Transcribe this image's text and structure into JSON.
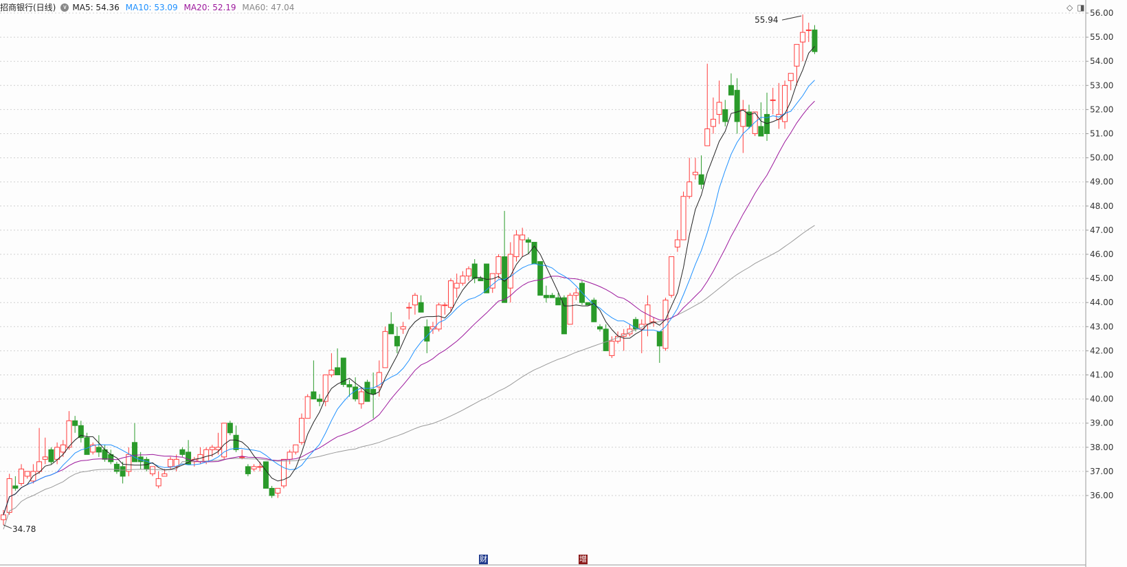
{
  "header": {
    "title": "招商银行(日线)",
    "ma5": "MA5: 54.36",
    "ma10": "MA10: 53.09",
    "ma20": "MA20: 52.19",
    "ma60": "MA60: 47.04"
  },
  "colors": {
    "up": "#ff3b3b",
    "down": "#2a9a2a",
    "ma5": "#222222",
    "ma10": "#1e90ff",
    "ma20": "#9c179c",
    "ma60": "#999999",
    "grid": "#cfcfcf"
  },
  "events": [
    {
      "label": "财",
      "color": "#1f3a8c"
    },
    {
      "label": "增",
      "color": "#8b1a1a"
    }
  ],
  "chart_data": {
    "type": "candlestick",
    "y_axis_side": "right",
    "ylim": [
      34.5,
      56.3
    ],
    "y_ticks": [
      "56.00",
      "55.00",
      "54.00",
      "53.00",
      "52.00",
      "51.00",
      "50.00",
      "49.00",
      "48.00",
      "47.00",
      "46.00",
      "45.00",
      "44.00",
      "43.00",
      "42.00",
      "41.00",
      "40.00",
      "39.00",
      "38.00",
      "37.00",
      "36.00"
    ],
    "annotations": [
      {
        "label": "55.94",
        "type": "period-high"
      },
      {
        "label": "34.78",
        "type": "period-low"
      }
    ],
    "candles": [
      [
        35.0,
        35.4,
        34.78,
        35.2
      ],
      [
        35.3,
        36.9,
        35.2,
        36.7
      ],
      [
        36.4,
        36.8,
        36.2,
        36.3
      ],
      [
        36.5,
        37.3,
        36.4,
        37.1
      ],
      [
        36.8,
        37.0,
        36.7,
        37.0
      ],
      [
        36.6,
        37.3,
        36.5,
        37.0
      ],
      [
        37.0,
        38.8,
        36.9,
        37.4
      ],
      [
        37.5,
        38.4,
        37.3,
        37.6
      ],
      [
        37.9,
        38.0,
        37.3,
        37.4
      ],
      [
        37.5,
        38.2,
        37.3,
        38.0
      ],
      [
        37.8,
        38.3,
        37.6,
        38.1
      ],
      [
        38.0,
        39.5,
        37.9,
        39.1
      ],
      [
        39.1,
        39.3,
        38.6,
        38.9
      ],
      [
        38.9,
        39.1,
        38.2,
        38.4
      ],
      [
        38.4,
        38.6,
        37.7,
        37.7
      ],
      [
        37.8,
        38.2,
        37.7,
        38.1
      ],
      [
        38.0,
        38.5,
        37.6,
        37.8
      ],
      [
        37.9,
        38.1,
        37.4,
        37.5
      ],
      [
        37.7,
        37.9,
        37.3,
        37.4
      ],
      [
        37.3,
        37.4,
        36.9,
        37.0
      ],
      [
        37.2,
        37.4,
        36.5,
        36.8
      ],
      [
        37.0,
        38.0,
        36.8,
        37.7
      ],
      [
        38.2,
        39.0,
        37.4,
        37.4
      ],
      [
        37.6,
        37.8,
        37.1,
        37.4
      ],
      [
        37.5,
        37.6,
        37.0,
        37.1
      ],
      [
        36.9,
        37.2,
        36.8,
        37.2
      ],
      [
        36.4,
        37.0,
        36.3,
        36.7
      ],
      [
        36.8,
        37.1,
        36.8,
        36.9
      ],
      [
        37.2,
        37.6,
        37.1,
        37.5
      ],
      [
        37.2,
        37.7,
        37.0,
        37.5
      ],
      [
        37.9,
        38.0,
        37.6,
        37.7
      ],
      [
        37.8,
        38.3,
        37.3,
        37.3
      ],
      [
        37.4,
        37.6,
        37.2,
        37.5
      ],
      [
        37.4,
        38.0,
        37.3,
        37.7
      ],
      [
        37.4,
        38.0,
        37.3,
        37.9
      ],
      [
        37.9,
        38.1,
        37.6,
        38.0
      ],
      [
        37.9,
        38.6,
        37.7,
        38.0
      ],
      [
        37.6,
        39.0,
        37.5,
        39.0
      ],
      [
        39.0,
        39.1,
        38.5,
        38.6
      ],
      [
        38.5,
        38.9,
        37.8,
        37.9
      ],
      [
        37.6,
        37.9,
        37.5,
        37.6
      ],
      [
        37.2,
        37.3,
        36.8,
        36.9
      ],
      [
        37.1,
        37.3,
        37.0,
        37.2
      ],
      [
        37.2,
        37.4,
        37.0,
        37.2
      ],
      [
        37.4,
        37.4,
        36.3,
        36.3
      ],
      [
        36.3,
        36.4,
        35.9,
        36.0
      ],
      [
        36.1,
        36.3,
        35.9,
        36.3
      ],
      [
        36.4,
        37.5,
        36.3,
        37.5
      ],
      [
        37.5,
        37.9,
        37.3,
        37.8
      ],
      [
        37.8,
        38.1,
        37.7,
        38.1
      ],
      [
        38.2,
        39.4,
        38.1,
        39.2
      ],
      [
        39.2,
        40.2,
        39.2,
        40.1
      ],
      [
        40.3,
        41.6,
        40.0,
        40.0
      ],
      [
        40.0,
        40.2,
        39.7,
        39.9
      ],
      [
        39.9,
        41.0,
        39.7,
        41.0
      ],
      [
        41.0,
        41.9,
        40.9,
        41.2
      ],
      [
        41.3,
        42.1,
        41.0,
        41.0
      ],
      [
        41.7,
        41.7,
        40.5,
        40.6
      ],
      [
        40.6,
        40.8,
        40.1,
        40.5
      ],
      [
        40.5,
        40.9,
        39.9,
        40.0
      ],
      [
        39.8,
        40.5,
        39.6,
        40.3
      ],
      [
        40.7,
        40.8,
        39.9,
        39.9
      ],
      [
        40.4,
        41.1,
        39.2,
        40.2
      ],
      [
        40.5,
        41.6,
        40.1,
        41.1
      ],
      [
        41.3,
        43.0,
        41.3,
        42.8
      ],
      [
        43.1,
        43.6,
        42.7,
        42.7
      ],
      [
        42.6,
        43.0,
        41.9,
        42.2
      ],
      [
        42.9,
        43.2,
        42.7,
        43.0
      ],
      [
        43.8,
        44.0,
        43.3,
        43.8
      ],
      [
        43.9,
        44.4,
        43.5,
        44.3
      ],
      [
        44.0,
        44.3,
        43.6,
        43.6
      ],
      [
        43.0,
        43.3,
        41.9,
        42.4
      ],
      [
        42.9,
        43.2,
        42.7,
        43.0
      ],
      [
        42.9,
        44.0,
        42.8,
        43.9
      ],
      [
        43.9,
        44.0,
        43.5,
        43.9
      ],
      [
        43.8,
        45.0,
        43.6,
        44.9
      ],
      [
        44.6,
        45.2,
        44.2,
        44.8
      ],
      [
        44.8,
        45.3,
        44.7,
        45.1
      ],
      [
        45.1,
        45.5,
        44.9,
        45.4
      ],
      [
        45.6,
        45.8,
        44.8,
        45.0
      ],
      [
        45.0,
        45.1,
        44.9,
        44.9
      ],
      [
        45.6,
        45.6,
        44.4,
        44.4
      ],
      [
        44.6,
        45.1,
        44.4,
        45.2
      ],
      [
        45.2,
        46.0,
        45.0,
        45.9
      ],
      [
        45.9,
        47.8,
        44.0,
        44.0
      ],
      [
        44.6,
        46.5,
        44.0,
        46.0
      ],
      [
        45.9,
        47.0,
        45.7,
        46.8
      ],
      [
        46.6,
        47.1,
        45.9,
        46.8
      ],
      [
        46.6,
        46.7,
        46.0,
        46.5
      ],
      [
        46.5,
        46.5,
        45.6,
        45.6
      ],
      [
        45.7,
        45.7,
        44.3,
        44.3
      ],
      [
        44.3,
        44.7,
        44.0,
        44.2
      ],
      [
        44.3,
        44.4,
        44.2,
        44.2
      ],
      [
        44.2,
        44.4,
        43.9,
        43.9
      ],
      [
        44.2,
        44.3,
        42.7,
        42.7
      ],
      [
        43.1,
        44.4,
        43.1,
        44.3
      ],
      [
        44.3,
        44.6,
        44.1,
        44.4
      ],
      [
        44.8,
        44.9,
        43.9,
        44.0
      ],
      [
        44.0,
        44.0,
        43.9,
        43.9
      ],
      [
        44.1,
        44.2,
        43.2,
        43.2
      ],
      [
        43.0,
        43.1,
        42.8,
        42.9
      ],
      [
        42.9,
        43.1,
        42.0,
        42.0
      ],
      [
        41.8,
        42.6,
        41.7,
        42.4
      ],
      [
        42.4,
        42.8,
        42.3,
        42.6
      ],
      [
        42.6,
        42.9,
        42.0,
        42.7
      ],
      [
        42.7,
        43.1,
        42.6,
        42.9
      ],
      [
        43.3,
        43.4,
        42.8,
        42.9
      ],
      [
        42.9,
        43.3,
        41.9,
        43.1
      ],
      [
        43.1,
        44.3,
        42.6,
        43.9
      ],
      [
        43.2,
        43.4,
        43.0,
        43.2
      ],
      [
        42.8,
        42.8,
        41.5,
        42.2
      ],
      [
        42.1,
        44.2,
        42.0,
        44.1
      ],
      [
        44.3,
        45.9,
        44.2,
        45.9
      ],
      [
        46.3,
        47.0,
        46.1,
        46.6
      ],
      [
        46.6,
        48.6,
        46.6,
        48.4
      ],
      [
        48.4,
        50.0,
        48.3,
        49.0
      ],
      [
        49.3,
        50.0,
        49.1,
        49.4
      ],
      [
        49.3,
        50.1,
        48.7,
        48.9
      ],
      [
        50.5,
        53.9,
        50.5,
        51.2
      ],
      [
        51.3,
        52.5,
        51.0,
        51.6
      ],
      [
        51.8,
        53.2,
        51.4,
        52.3
      ],
      [
        52.0,
        52.4,
        51.3,
        51.5
      ],
      [
        53.0,
        53.5,
        52.6,
        52.6
      ],
      [
        52.8,
        53.3,
        51.0,
        51.5
      ],
      [
        51.3,
        52.4,
        50.2,
        52.0
      ],
      [
        51.9,
        52.2,
        51.2,
        51.3
      ],
      [
        51.0,
        51.6,
        50.9,
        51.9
      ],
      [
        51.3,
        52.3,
        50.9,
        50.9
      ],
      [
        51.8,
        52.7,
        50.7,
        51.0
      ],
      [
        52.4,
        52.9,
        51.8,
        52.4
      ],
      [
        51.6,
        53.1,
        51.2,
        51.8
      ],
      [
        51.5,
        53.2,
        51.2,
        53.0
      ],
      [
        53.2,
        53.5,
        52.8,
        53.5
      ],
      [
        53.8,
        54.7,
        53.0,
        54.7
      ],
      [
        54.8,
        55.94,
        54.0,
        55.2
      ],
      [
        55.3,
        55.6,
        54.8,
        55.3
      ],
      [
        55.3,
        55.5,
        54.3,
        54.4
      ]
    ]
  }
}
